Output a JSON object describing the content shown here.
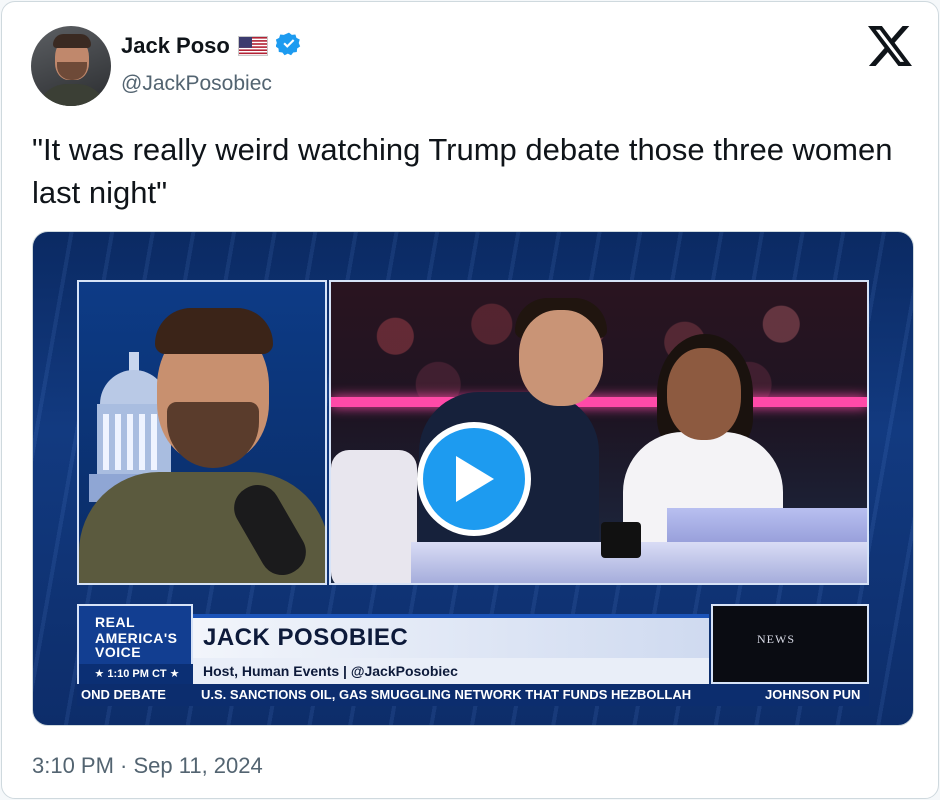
{
  "author": {
    "display_name": "Jack Poso",
    "handle": "@JackPosobiec",
    "flag_icon": "us-flag-icon",
    "verified_icon": "verified-badge-icon",
    "verified_color": "#1d9bf0"
  },
  "tweet": {
    "text": "\"It was really weird watching Trump debate those three women last night\"",
    "timestamp": "3:10 PM · Sep 11, 2024"
  },
  "brand_icon": "x-logo-icon",
  "video": {
    "play_icon": "play-icon",
    "lower_third": {
      "logo_line1": "REAL",
      "logo_line2": "AMERICA'S",
      "logo_line3": "VOICE",
      "time": "★ 1:10 PM CT ★",
      "name": "JACK POSOBIEC",
      "subtitle": "Host, Human Events | @JackPosobiec",
      "thumb_text": "NEWS"
    },
    "ticker": {
      "item1": "OND DEBATE",
      "item2": "U.S. SANCTIONS OIL, GAS SMUGGLING NETWORK THAT FUNDS HEZBOLLAH",
      "item3": "JOHNSON PUN"
    }
  },
  "colors": {
    "accent": "#1d9bf0",
    "text_primary": "#0f1419",
    "text_secondary": "#536471"
  }
}
